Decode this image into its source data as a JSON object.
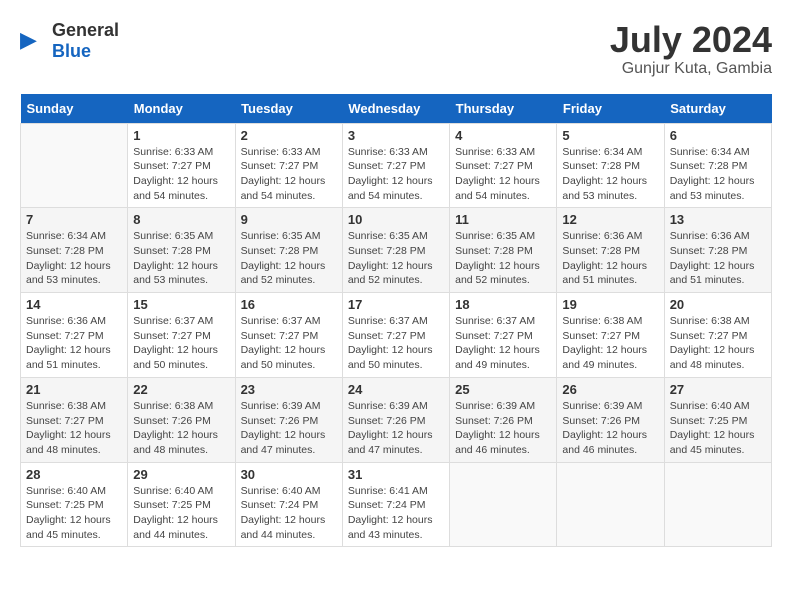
{
  "header": {
    "logo_general": "General",
    "logo_blue": "Blue",
    "title": "July 2024",
    "subtitle": "Gunjur Kuta, Gambia"
  },
  "weekdays": [
    "Sunday",
    "Monday",
    "Tuesday",
    "Wednesday",
    "Thursday",
    "Friday",
    "Saturday"
  ],
  "weeks": [
    [
      {
        "day": "",
        "sunrise": "",
        "sunset": "",
        "daylight": ""
      },
      {
        "day": "1",
        "sunrise": "6:33 AM",
        "sunset": "7:27 PM",
        "daylight": "12 hours and 54 minutes."
      },
      {
        "day": "2",
        "sunrise": "6:33 AM",
        "sunset": "7:27 PM",
        "daylight": "12 hours and 54 minutes."
      },
      {
        "day": "3",
        "sunrise": "6:33 AM",
        "sunset": "7:27 PM",
        "daylight": "12 hours and 54 minutes."
      },
      {
        "day": "4",
        "sunrise": "6:33 AM",
        "sunset": "7:27 PM",
        "daylight": "12 hours and 54 minutes."
      },
      {
        "day": "5",
        "sunrise": "6:34 AM",
        "sunset": "7:28 PM",
        "daylight": "12 hours and 53 minutes."
      },
      {
        "day": "6",
        "sunrise": "6:34 AM",
        "sunset": "7:28 PM",
        "daylight": "12 hours and 53 minutes."
      }
    ],
    [
      {
        "day": "7",
        "sunrise": "6:34 AM",
        "sunset": "7:28 PM",
        "daylight": "12 hours and 53 minutes."
      },
      {
        "day": "8",
        "sunrise": "6:35 AM",
        "sunset": "7:28 PM",
        "daylight": "12 hours and 53 minutes."
      },
      {
        "day": "9",
        "sunrise": "6:35 AM",
        "sunset": "7:28 PM",
        "daylight": "12 hours and 52 minutes."
      },
      {
        "day": "10",
        "sunrise": "6:35 AM",
        "sunset": "7:28 PM",
        "daylight": "12 hours and 52 minutes."
      },
      {
        "day": "11",
        "sunrise": "6:35 AM",
        "sunset": "7:28 PM",
        "daylight": "12 hours and 52 minutes."
      },
      {
        "day": "12",
        "sunrise": "6:36 AM",
        "sunset": "7:28 PM",
        "daylight": "12 hours and 51 minutes."
      },
      {
        "day": "13",
        "sunrise": "6:36 AM",
        "sunset": "7:28 PM",
        "daylight": "12 hours and 51 minutes."
      }
    ],
    [
      {
        "day": "14",
        "sunrise": "6:36 AM",
        "sunset": "7:27 PM",
        "daylight": "12 hours and 51 minutes."
      },
      {
        "day": "15",
        "sunrise": "6:37 AM",
        "sunset": "7:27 PM",
        "daylight": "12 hours and 50 minutes."
      },
      {
        "day": "16",
        "sunrise": "6:37 AM",
        "sunset": "7:27 PM",
        "daylight": "12 hours and 50 minutes."
      },
      {
        "day": "17",
        "sunrise": "6:37 AM",
        "sunset": "7:27 PM",
        "daylight": "12 hours and 50 minutes."
      },
      {
        "day": "18",
        "sunrise": "6:37 AM",
        "sunset": "7:27 PM",
        "daylight": "12 hours and 49 minutes."
      },
      {
        "day": "19",
        "sunrise": "6:38 AM",
        "sunset": "7:27 PM",
        "daylight": "12 hours and 49 minutes."
      },
      {
        "day": "20",
        "sunrise": "6:38 AM",
        "sunset": "7:27 PM",
        "daylight": "12 hours and 48 minutes."
      }
    ],
    [
      {
        "day": "21",
        "sunrise": "6:38 AM",
        "sunset": "7:27 PM",
        "daylight": "12 hours and 48 minutes."
      },
      {
        "day": "22",
        "sunrise": "6:38 AM",
        "sunset": "7:26 PM",
        "daylight": "12 hours and 48 minutes."
      },
      {
        "day": "23",
        "sunrise": "6:39 AM",
        "sunset": "7:26 PM",
        "daylight": "12 hours and 47 minutes."
      },
      {
        "day": "24",
        "sunrise": "6:39 AM",
        "sunset": "7:26 PM",
        "daylight": "12 hours and 47 minutes."
      },
      {
        "day": "25",
        "sunrise": "6:39 AM",
        "sunset": "7:26 PM",
        "daylight": "12 hours and 46 minutes."
      },
      {
        "day": "26",
        "sunrise": "6:39 AM",
        "sunset": "7:26 PM",
        "daylight": "12 hours and 46 minutes."
      },
      {
        "day": "27",
        "sunrise": "6:40 AM",
        "sunset": "7:25 PM",
        "daylight": "12 hours and 45 minutes."
      }
    ],
    [
      {
        "day": "28",
        "sunrise": "6:40 AM",
        "sunset": "7:25 PM",
        "daylight": "12 hours and 45 minutes."
      },
      {
        "day": "29",
        "sunrise": "6:40 AM",
        "sunset": "7:25 PM",
        "daylight": "12 hours and 44 minutes."
      },
      {
        "day": "30",
        "sunrise": "6:40 AM",
        "sunset": "7:24 PM",
        "daylight": "12 hours and 44 minutes."
      },
      {
        "day": "31",
        "sunrise": "6:41 AM",
        "sunset": "7:24 PM",
        "daylight": "12 hours and 43 minutes."
      },
      {
        "day": "",
        "sunrise": "",
        "sunset": "",
        "daylight": ""
      },
      {
        "day": "",
        "sunrise": "",
        "sunset": "",
        "daylight": ""
      },
      {
        "day": "",
        "sunrise": "",
        "sunset": "",
        "daylight": ""
      }
    ]
  ],
  "labels": {
    "sunrise_prefix": "Sunrise: ",
    "sunset_prefix": "Sunset: ",
    "daylight_prefix": "Daylight: "
  }
}
